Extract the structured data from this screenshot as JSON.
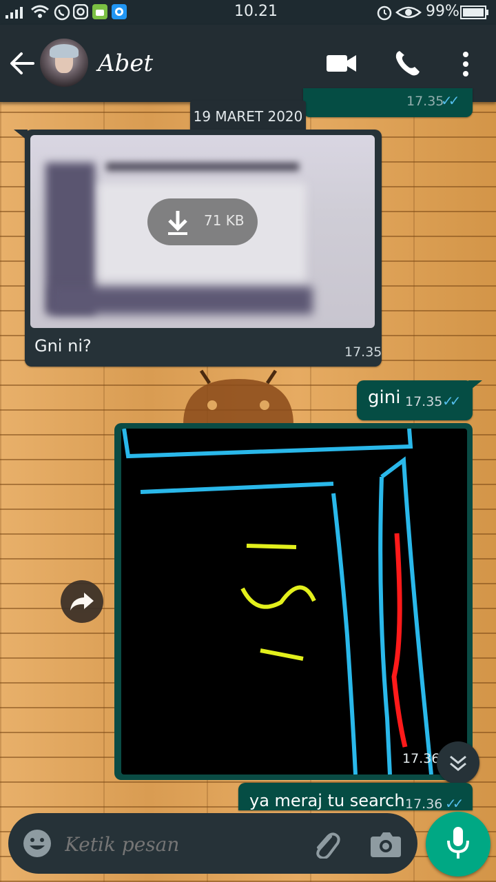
{
  "status_bar": {
    "time": "10.21",
    "battery": "99%"
  },
  "header": {
    "contact_name": "Abet",
    "icons": [
      "back-arrow-icon",
      "avatar",
      "video-call-icon",
      "phone-icon",
      "more-vert-icon"
    ]
  },
  "chat": {
    "date_chip": "19 MARET 2020",
    "partial_top_time": "17.35",
    "messages": [
      {
        "id": "m1",
        "direction": "in",
        "type": "image",
        "download_size": "71 KB",
        "caption": "Gni ni?",
        "time": "17.35"
      },
      {
        "id": "m2",
        "direction": "out",
        "type": "text",
        "text": "gini",
        "time": "17.35"
      },
      {
        "id": "m3",
        "direction": "in",
        "type": "image",
        "time": "17.36"
      },
      {
        "id": "m4",
        "direction": "out",
        "type": "text",
        "text": "ya meraj tu search",
        "time": "17.36"
      }
    ]
  },
  "input": {
    "placeholder": "Ketik pesan"
  },
  "colors": {
    "header_bg": "#232d33",
    "incoming_bubble": "#263238",
    "outgoing_bubble": "#054d44",
    "mic_button": "#00a884",
    "read_ticks": "#53bdeb"
  }
}
